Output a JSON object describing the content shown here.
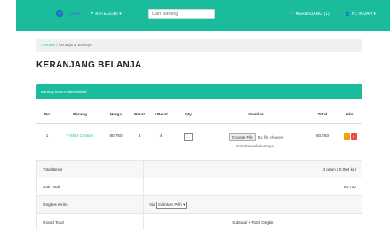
{
  "navbar": {
    "logo_text": "TOKO",
    "kategori": "▼ KATEGORI ▾",
    "search_placeholder": "Cari Barang",
    "keranjang": "🛒 KERANJANG (1)",
    "user": "👤 HI, INDAH ▾",
    "color": "#1abc9c"
  },
  "breadcrumb": {
    "home": "⌂ Home",
    "separator": "/",
    "current": "Keranjang Belanja"
  },
  "page_title": "KERANJANG BELANJA",
  "panel": {
    "title": "Barang belum dibeli/dibeli"
  },
  "table": {
    "headers": [
      "No",
      "Barang",
      "Harga",
      "Berat",
      "J.Berat",
      "Qty",
      "Gambar",
      "Total",
      "Aksi"
    ],
    "rows": [
      {
        "no": "1",
        "barang": "T-Shirt Custom",
        "harga": "80.750",
        "berat": "4",
        "jberat": "4",
        "qty": "1",
        "file_button": "Choose File",
        "file_status": "No file chosen",
        "gambar_caption": "Gambar sebelumnya :",
        "total": "80.750",
        "edit_icon": "!",
        "delete_icon": "×"
      }
    ]
  },
  "summary": {
    "total_berat_label": "Total Berat",
    "total_berat_value": "4 gram ( 0.004 kg)",
    "subtotal_label": "Sub Total",
    "subtotal_value": "80.750",
    "ongkos_label": "Ongkos Kirim",
    "via_label": "Via",
    "ongkos_select": "Silahkan Pilih",
    "grand_label": "Grand Total",
    "grand_value": "Subtotal + Total Ongkir"
  },
  "colors": {
    "accent": "#1abc9c",
    "warning": "#f39c12",
    "danger": "#e74c3c"
  }
}
